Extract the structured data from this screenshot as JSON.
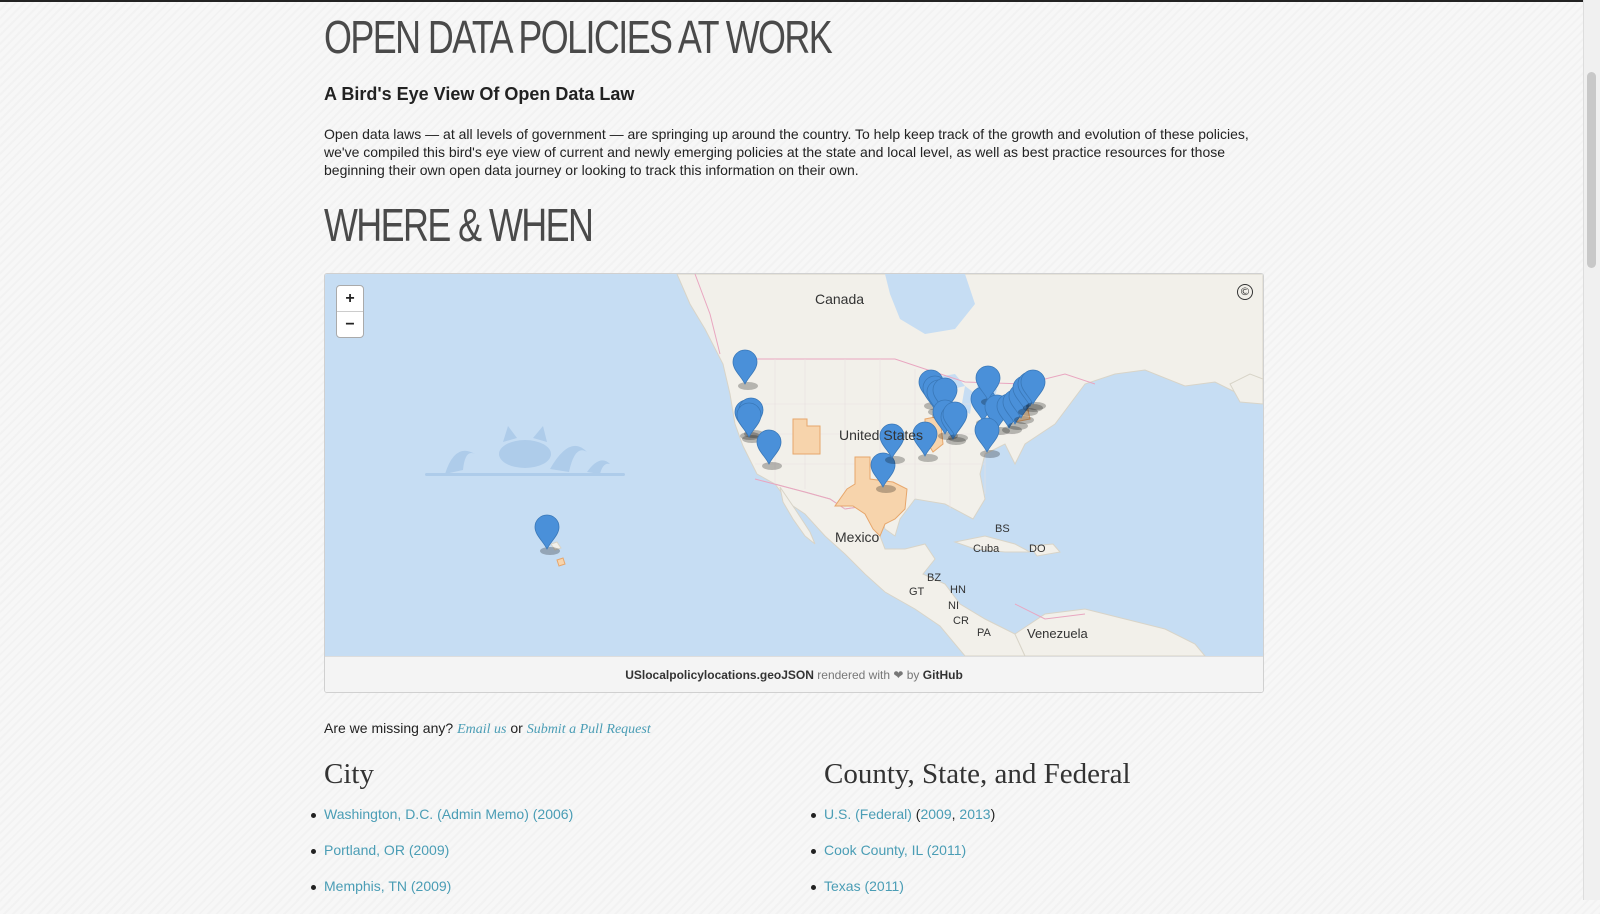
{
  "page": {
    "title": "OPEN DATA POLICIES AT WORK",
    "subtitle": "A Bird's Eye View Of Open Data Law",
    "intro": "Open data laws — at all levels of government — are springing up around the country. To help keep track of the growth and evolution of these policies, we've compiled this bird's eye view of current and newly emerging policies at the state and local level, as well as best practice resources for those beginning their own open data journey or looking to track this information on their own.",
    "section_title": "WHERE & WHEN"
  },
  "map": {
    "zoom_in": "+",
    "zoom_out": "−",
    "copyright_symbol": "©",
    "labels": {
      "canada": "Canada",
      "united_states": "United States",
      "mexico": "Mexico",
      "bs": "BS",
      "cuba": "Cuba",
      "do": "DO",
      "bz": "BZ",
      "gt": "GT",
      "hn": "HN",
      "ni": "NI",
      "cr": "CR",
      "pa": "PA",
      "venezuela": "Venezuela"
    },
    "footer": {
      "filename": "USlocalpolicylocations.geoJSON",
      "rendered_with": "rendered with",
      "heart": "❤",
      "by": "by",
      "github": "GitHub"
    },
    "marker_color": "#4a90d9",
    "highlight_color": "#f7c99a"
  },
  "missing": {
    "text": "Are we missing any?",
    "email_link": "Email us",
    "or": "or",
    "pr_link": "Submit a Pull Request"
  },
  "city": {
    "heading": "City",
    "items": [
      "Washington, D.C. (Admin Memo) (2006)",
      "Portland, OR (2009)",
      "Memphis, TN (2009)"
    ]
  },
  "county": {
    "heading": "County, State, and Federal",
    "item1": {
      "link": "U.S. (Federal)",
      "open": " (",
      "year1": "2009",
      "sep": ", ",
      "year2": "2013",
      "close": ")"
    },
    "items": [
      "Cook County, IL (2011)",
      "Texas (2011)"
    ]
  }
}
